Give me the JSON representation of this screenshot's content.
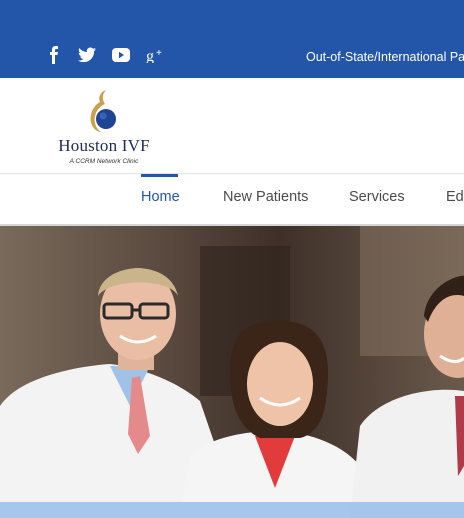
{
  "topbar": {
    "social": [
      "facebook-icon",
      "twitter-icon",
      "youtube-icon",
      "google-plus-icon"
    ],
    "out_of_state_link": "Out-of-State/International Pati"
  },
  "logo": {
    "name": "Houston IVF",
    "tagline": "A CCRM Network Clinic"
  },
  "nav": {
    "items": [
      "Home",
      "New Patients",
      "Services",
      "Edu"
    ],
    "active": "Home"
  },
  "hero": {
    "photo": "Three physicians in white lab coats"
  },
  "colors": {
    "brand_blue": "#2356a9",
    "logo_gold": "#c9a14a",
    "logo_navy": "#1e2c57"
  }
}
